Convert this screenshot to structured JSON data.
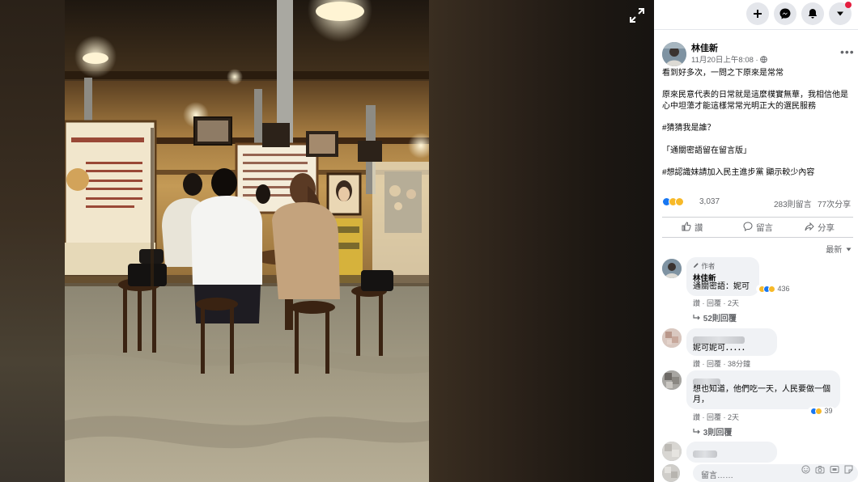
{
  "post": {
    "author": "林佳新",
    "date": "11月20日上午8:08 · ",
    "paragraphs": [
      "看到好多次，一問之下原來是常常",
      "原來民意代表的日常就是這麼樸實無華，我相信他是心中坦蕩才能這樣常常光明正大的選民服務",
      "#猜猜我是誰？",
      "「通關密語留在留言版」",
      "#想認識妹請加入民主進步黨 顯示較少內容"
    ],
    "reaction_count": "3,037",
    "comment_count": "283則留言",
    "share_count": "77次分享"
  },
  "actions": {
    "like": "讚",
    "comment": "留言",
    "share": "分享"
  },
  "sort_label": "最新",
  "comments": [
    {
      "badge": "作者",
      "name": "林佳新",
      "text": "通關密語：妮可",
      "reactions": "436",
      "like": "讚",
      "reply": "回覆",
      "time": "2天",
      "replies": "52則回覆"
    },
    {
      "name": "",
      "text": "妮可妮可．．．．．",
      "like": "讚",
      "reply": "回覆",
      "time": "38分鐘"
    },
    {
      "name": "",
      "text": "想也知道，他們吃一天，人民要做一個月，",
      "reactions": "39",
      "like": "讚",
      "reply": "回覆",
      "time": "2天",
      "replies": "3則回覆"
    },
    {
      "name": "",
      "text": "",
      "like": "",
      "reply": "",
      "time": ""
    }
  ],
  "composer": {
    "placeholder": "留言……"
  },
  "topbar": {
    "icons": [
      "plus-icon",
      "messenger-icon",
      "bell-icon",
      "caret-down-icon"
    ],
    "notification_color": "#e41e3f"
  },
  "colors": {
    "like_blue": "#1877f2",
    "haha_yellow": "#f7b928",
    "link_gray": "#65676b"
  }
}
